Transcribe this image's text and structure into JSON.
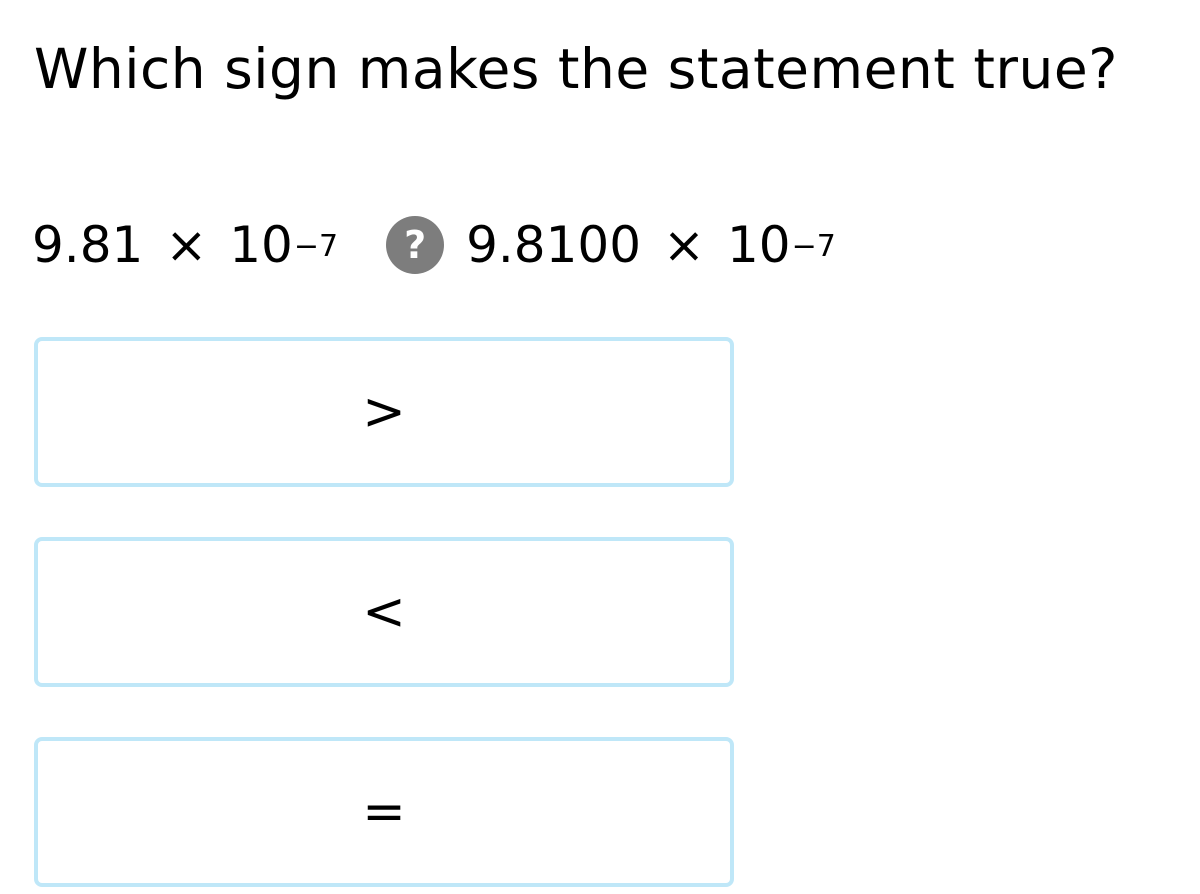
{
  "question": "Which sign makes the statement true?",
  "left_term": {
    "mantissa": "9.81",
    "times": "×",
    "base": "10",
    "exponent": "−7"
  },
  "unknown_sign": "?",
  "right_term": {
    "mantissa": "9.8100",
    "times": "×",
    "base": "10",
    "exponent": "−7"
  },
  "choices": [
    {
      "label": ">"
    },
    {
      "label": "<"
    },
    {
      "label": "="
    }
  ],
  "colors": {
    "choice_border": "#bfe7f8",
    "unknown_sign_background": "#7d7d7d"
  },
  "icons": {
    "unknown_sign": "question-mark-circle-icon"
  }
}
